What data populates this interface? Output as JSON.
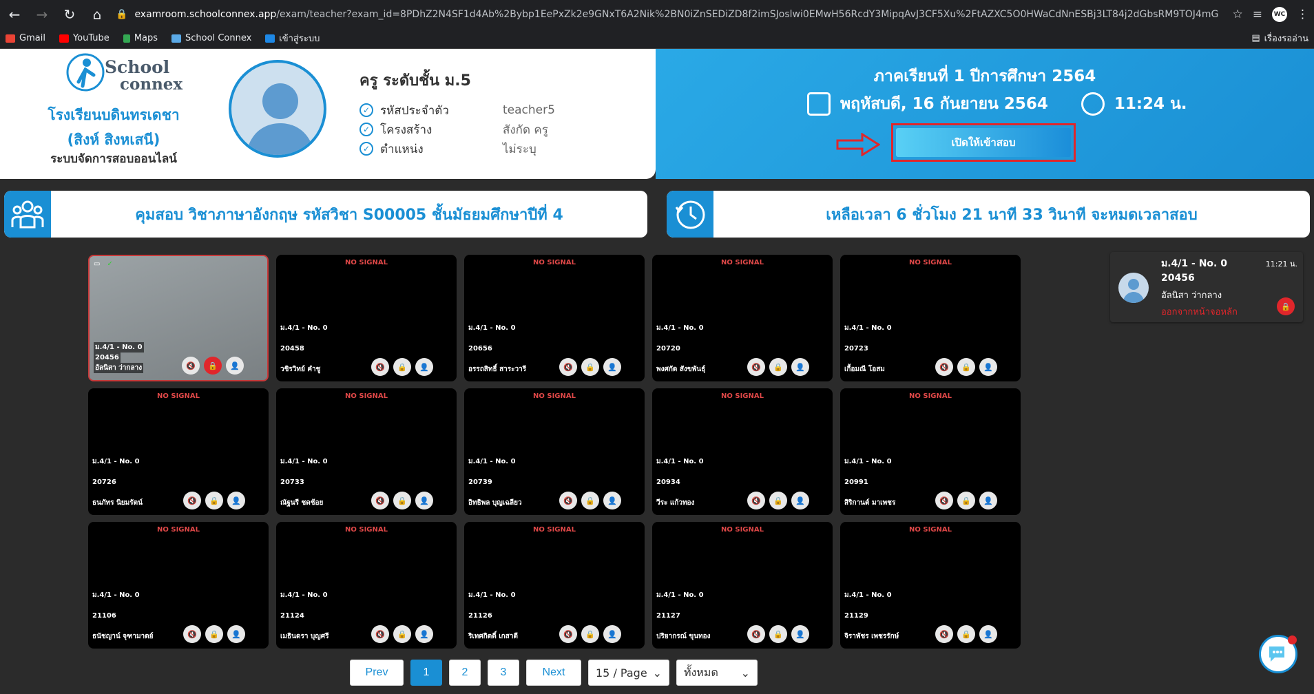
{
  "browser": {
    "url_host": "examroom.schoolconnex.app",
    "url_path": "/exam/teacher?exam_id=8PDhZ2N4SF1d4Ab%2Bybp1EePxZk2e9GNxT6A2Nik%2BN0iZnSEDiZD8f2imSJoslwi0EMwH56RcdY3MipqAvJ3CF5Xu%2FtAZXC5O0HWaCdNnESBj3LT84j2dGbsRM9TOJ4mG",
    "profile_initials": "WC",
    "bookmarks": [
      "Gmail",
      "YouTube",
      "Maps",
      "School Connex",
      "เข้าสู่ระบบ"
    ],
    "reading_list": "เรื่องรออ่าน"
  },
  "header": {
    "logo_line1": "School",
    "logo_line2": "connex",
    "school_name_1": "โรงเรียนบดินทรเดชา",
    "school_name_2": "(สิงห์ สิงหเสนี)",
    "system_name": "ระบบจัดการสอบออนไลน์",
    "teacher_title": "ครู ระดับชั้น ม.5",
    "info": [
      {
        "key": "รหัสประจำตัว",
        "value": "teacher5"
      },
      {
        "key": "โครงสร้าง",
        "value": "สังกัด ครู"
      },
      {
        "key": "ตำแหน่ง",
        "value": "ไม่ระบุ"
      }
    ],
    "semester": "ภาคเรียนที่ 1 ปีการศึกษา 2564",
    "date": "พฤหัสบดี, 16 กันยายน 2564",
    "time": "11:24 น.",
    "open_button": "เปิดให้เข้าสอบ"
  },
  "bars": {
    "exam": "คุมสอบ วิชาภาษาอังกฤษ รหัสวิชา S00005 ชั้นมัธยมศึกษาปีที่ 4",
    "remaining": "เหลือเวลา 6 ชั่วโมง 21 นาที 33 วินาที จะหมดเวลาสอบ"
  },
  "tiles": [
    {
      "cls": "ม.4/1 - No. 0",
      "id": "20456",
      "name": "อัลนิสา ว่ากลาง",
      "active": true,
      "nosignal": ""
    },
    {
      "cls": "ม.4/1 - No. 0",
      "id": "20458",
      "name": "วชิรวิทย์ คำชู",
      "active": false,
      "nosignal": "NO SIGNAL"
    },
    {
      "cls": "ม.4/1 - No. 0",
      "id": "20656",
      "name": "อรรถสิทธิ์ สาระวารี",
      "active": false,
      "nosignal": "NO SIGNAL"
    },
    {
      "cls": "ม.4/1 - No. 0",
      "id": "20720",
      "name": "พงศกัด สังขพันธุ์",
      "active": false,
      "nosignal": "NO SIGNAL"
    },
    {
      "cls": "ม.4/1 - No. 0",
      "id": "20723",
      "name": "เกื้อมณี โอสม",
      "active": false,
      "nosignal": "NO SIGNAL"
    },
    {
      "cls": "ม.4/1 - No. 0",
      "id": "20726",
      "name": "ธนภัทร นิยมรัตน์",
      "active": false,
      "nosignal": "NO SIGNAL"
    },
    {
      "cls": "ม.4/1 - No. 0",
      "id": "20733",
      "name": "ณัฐนรี ชดช้อย",
      "active": false,
      "nosignal": "NO SIGNAL"
    },
    {
      "cls": "ม.4/1 - No. 0",
      "id": "20739",
      "name": "อิทธิพล บุญเฉลียว",
      "active": false,
      "nosignal": "NO SIGNAL"
    },
    {
      "cls": "ม.4/1 - No. 0",
      "id": "20934",
      "name": "วีระ แก้วทอง",
      "active": false,
      "nosignal": "NO SIGNAL"
    },
    {
      "cls": "ม.4/1 - No. 0",
      "id": "20991",
      "name": "สิริกานต์ มาเพชร",
      "active": false,
      "nosignal": "NO SIGNAL"
    },
    {
      "cls": "ม.4/1 - No. 0",
      "id": "21106",
      "name": "ธนัชญาน์ จุฑามาตย์",
      "active": false,
      "nosignal": "NO SIGNAL"
    },
    {
      "cls": "ม.4/1 - No. 0",
      "id": "21124",
      "name": "เมธินดรา บุญศรี",
      "active": false,
      "nosignal": "NO SIGNAL"
    },
    {
      "cls": "ม.4/1 - No. 0",
      "id": "21126",
      "name": "ริเทศกิตติ์ เกสาตี",
      "active": false,
      "nosignal": "NO SIGNAL"
    },
    {
      "cls": "ม.4/1 - No. 0",
      "id": "21127",
      "name": "ปริยากรณ์ ขุนทอง",
      "active": false,
      "nosignal": "NO SIGNAL"
    },
    {
      "cls": "ม.4/1 - No. 0",
      "id": "21129",
      "name": "จิราพัชร เพชรรักษ์",
      "active": false,
      "nosignal": "NO SIGNAL"
    }
  ],
  "notification": {
    "cls": "ม.4/1 - No. 0",
    "time": "11:21 น.",
    "id": "20456",
    "name": "อัลนิสา ว่ากลาง",
    "status": "ออกจากหน้าจอหลัก"
  },
  "pager": {
    "prev": "Prev",
    "pages": [
      "1",
      "2",
      "3"
    ],
    "current": "1",
    "next": "Next",
    "per_page": "15 / Page",
    "filter": "ทั้งหมด"
  }
}
